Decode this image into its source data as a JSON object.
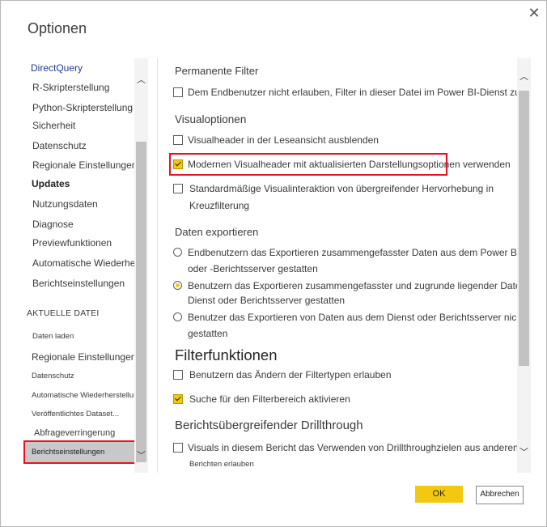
{
  "dialog": {
    "title": "Optionen"
  },
  "nav": {
    "global_items": [
      "DirectQuery",
      "R-Skripterstellung",
      "Python-Skripterstellung",
      "Sicherheit",
      "Datenschutz",
      "Regionale Einstellungen",
      "Updates",
      "Nutzungsdaten",
      "Diagnose",
      "Previewfunktionen",
      "Automatische Wiederherstellung",
      "Berichtseinstellungen"
    ],
    "section_label": "AKTUELLE DATEI",
    "file_items": [
      "Daten laden",
      "Regionale Einstellungen",
      "Datenschutz",
      "Automatische Wiederherstellung",
      "Veröffentlichtes Dataset...",
      "Abfrageverringerung"
    ],
    "selected_item": "Berichtseinstellungen"
  },
  "content": {
    "permanent_filter": {
      "heading": "Permanente Filter",
      "option": "Dem Endbenutzer nicht erlauben, Filter in dieser Datei im Power BI-Dienst zu speichern"
    },
    "visual_options": {
      "heading": "Visualoptionen",
      "opt1": "Visualheader in der Leseansicht ausblenden",
      "opt2": "Modernen Visualheader mit aktualisierten Darstellungsoptionen verwenden",
      "opt3_line1": "Standardmäßige Visualinteraktion von übergreifender Hervorhebung in",
      "opt3_line2": "Kreuzfilterung"
    },
    "export": {
      "heading": "Daten exportieren",
      "r1_line1": "Endbenutzern das Exportieren zusammengefasster Daten aus dem Power BI-Dienst",
      "r1_line2": "oder -Berichtsserver gestatten",
      "r2_line1": "Benutzern das Exportieren zusammengefasster und zugrunde liegender Daten aus dem",
      "r2_line2": "Dienst oder Berichtsserver gestatten",
      "r3_line1": "Benutzer das Exportieren von Daten aus dem Dienst oder Berichtsserver nicht",
      "r3_line2": "gestatten"
    },
    "filter_functions": {
      "heading": "Filterfunktionen",
      "opt1": "Benutzern das Ändern der Filtertypen erlauben",
      "opt2": "Suche für den Filterbereich aktivieren"
    },
    "drillthrough": {
      "heading": "Berichtsübergreifender Drillthrough",
      "opt_line1": "Visuals in diesem Bericht das Verwenden von Drillthroughzielen aus anderen",
      "opt_line2": "Berichten erlauben"
    }
  },
  "footer": {
    "ok": "OK",
    "cancel": "Abbrechen"
  },
  "colors": {
    "accent": "#f2c811",
    "highlight": "#e81123"
  }
}
